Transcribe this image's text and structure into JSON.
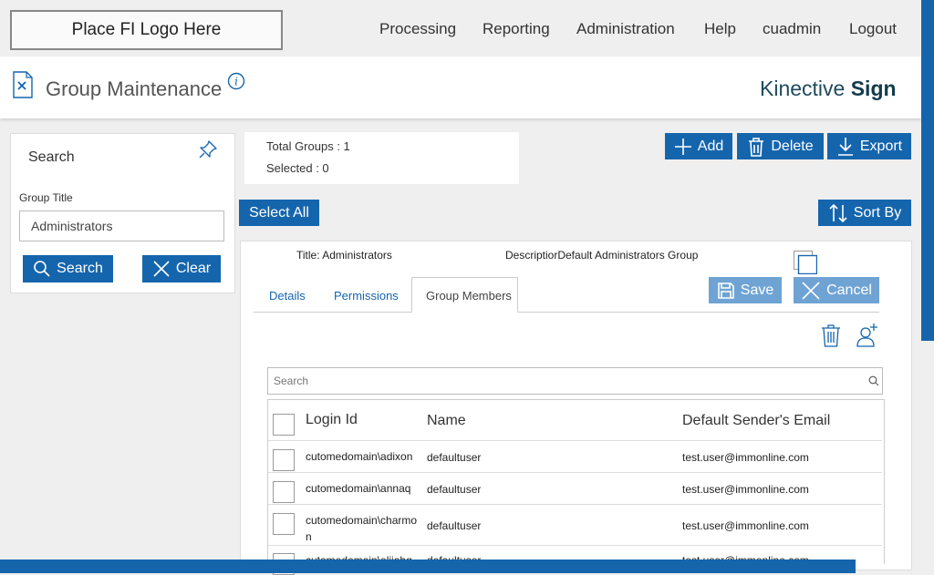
{
  "topbar": {
    "logo_text": "Place FI Logo Here",
    "nav": [
      "Processing",
      "Reporting",
      "Administration",
      "Help",
      "cuadmin",
      "Logout"
    ]
  },
  "header": {
    "title": "Group Maintenance",
    "brand_light": "Kinective ",
    "brand_bold": "Sign"
  },
  "search_panel": {
    "title": "Search",
    "field_label": "Group Title",
    "field_value": "Administrators",
    "search_label": "Search",
    "clear_label": "Clear"
  },
  "summary": {
    "total_groups": "Total Groups : 1",
    "selected": "Selected : 0"
  },
  "toolbar": {
    "add_label": "Add",
    "delete_label": "Delete",
    "export_label": "Export",
    "select_all_label": "Select All",
    "sort_by_label": "Sort By"
  },
  "group_card": {
    "title_text": "Title: Administrators",
    "description_text": "DescriptiorDefault Administrators Group",
    "tabs": [
      "Details",
      "Permissions",
      "Group Members"
    ],
    "active_tab": "Group Members",
    "save_label": "Save",
    "cancel_label": "Cancel",
    "search_placeholder": "Search"
  },
  "members_table": {
    "columns": [
      "Login Id",
      "Name",
      "Default Sender's Email"
    ],
    "rows": [
      {
        "login": "cutomedomain\\adixon",
        "name": "defaultuser",
        "email": "test.user@immonline.com"
      },
      {
        "login": "cutomedomain\\annaq",
        "name": "defaultuser",
        "email": "test.user@immonline.com"
      },
      {
        "login_line1": "cutomedomain\\charmo",
        "login_line2": "n",
        "name": "defaultuser",
        "email": "test.user@immonline.com"
      },
      {
        "login": "cutomedomain\\elijahg",
        "name": "defaultuser",
        "email": "test.user@immonline.com"
      }
    ]
  },
  "colors": {
    "primary": "#1565ad",
    "primary_light": "#6fa3d4",
    "brand": "#1f4a5c"
  }
}
